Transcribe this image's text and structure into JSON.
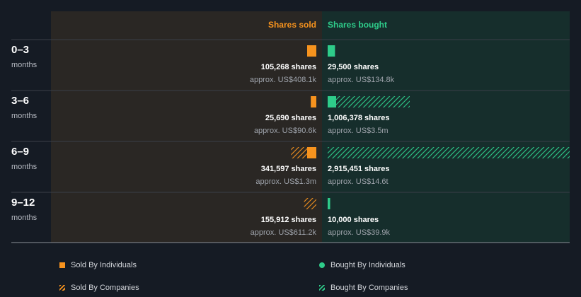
{
  "colors": {
    "sold": "#f7931e",
    "bought": "#2ecc8a",
    "sold_panel": "#2a2724",
    "bought_panel": "#162e2c",
    "background": "#151b24"
  },
  "chart_data": {
    "type": "bar",
    "orientation": "horizontal-diverging",
    "columns": {
      "sold": "Shares sold",
      "bought": "Shares bought"
    },
    "rows": [
      {
        "label": "0–3",
        "sub": "months",
        "sold": {
          "shares": 105268,
          "shares_text": "105,268 shares",
          "value_text": "approx. US$408.1k",
          "individuals": 105268,
          "companies": 0
        },
        "bought": {
          "shares": 29500,
          "shares_text": "29,500 shares",
          "value_text": "approx. US$134.8k",
          "individuals": 29500,
          "companies": 0
        }
      },
      {
        "label": "3–6",
        "sub": "months",
        "sold": {
          "shares": 25690,
          "shares_text": "25,690 shares",
          "value_text": "approx. US$90.6k",
          "individuals": 25690,
          "companies": 0
        },
        "bought": {
          "shares": 1006378,
          "shares_text": "1,006,378 shares",
          "value_text": "approx. US$3.5m",
          "individuals": 120000,
          "companies": 886378
        }
      },
      {
        "label": "6–9",
        "sub": "months",
        "sold": {
          "shares": 341597,
          "shares_text": "341,597 shares",
          "value_text": "approx. US$1.3m",
          "individuals": 70000,
          "companies": 271597
        },
        "bought": {
          "shares": 2915451,
          "shares_text": "2,915,451 shares",
          "value_text": "approx. US$14.6t",
          "individuals": 0,
          "companies": 2915451
        }
      },
      {
        "label": "9–12",
        "sub": "months",
        "sold": {
          "shares": 155912,
          "shares_text": "155,912 shares",
          "value_text": "approx. US$611.2k",
          "individuals": 0,
          "companies": 155912
        },
        "bought": {
          "shares": 10000,
          "shares_text": "10,000 shares",
          "value_text": "approx. US$39.9k",
          "individuals": 10000,
          "companies": 0
        }
      }
    ],
    "legend": [
      {
        "key": "sold_individuals",
        "label": "Sold By Individuals"
      },
      {
        "key": "bought_individuals",
        "label": "Bought By Individuals"
      },
      {
        "key": "sold_companies",
        "label": "Sold By Companies"
      },
      {
        "key": "bought_companies",
        "label": "Bought By Companies"
      }
    ]
  }
}
